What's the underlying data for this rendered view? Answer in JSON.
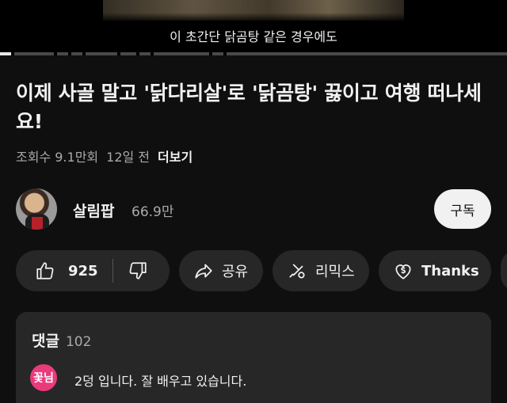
{
  "video": {
    "caption": "이 초간단 닭곰탕 같은 경우에도",
    "progress_played": 0.02
  },
  "title": "이제 사골 말고 '닭다리살'로 '닭곰탕' 끓이고 여행 떠나세요!",
  "meta": {
    "views": "조회수 9.1만회",
    "age": "12일 전",
    "more": "더보기"
  },
  "channel": {
    "name": "살림팝",
    "subscribers": "66.9만",
    "subscribe_label": "구독"
  },
  "actions": {
    "like_count": "925",
    "share_label": "공유",
    "remix_label": "리믹스",
    "thanks_label": "Thanks"
  },
  "comments": {
    "label": "댓글",
    "count": "102",
    "top_comment": {
      "avatar_text": "꽃님",
      "text": "2덩 입니다. 잘 배우고  있습니다."
    }
  },
  "colors": {
    "background": "#0f0f0f",
    "pill": "#272727",
    "avatar_pink": "#e93b7c"
  }
}
